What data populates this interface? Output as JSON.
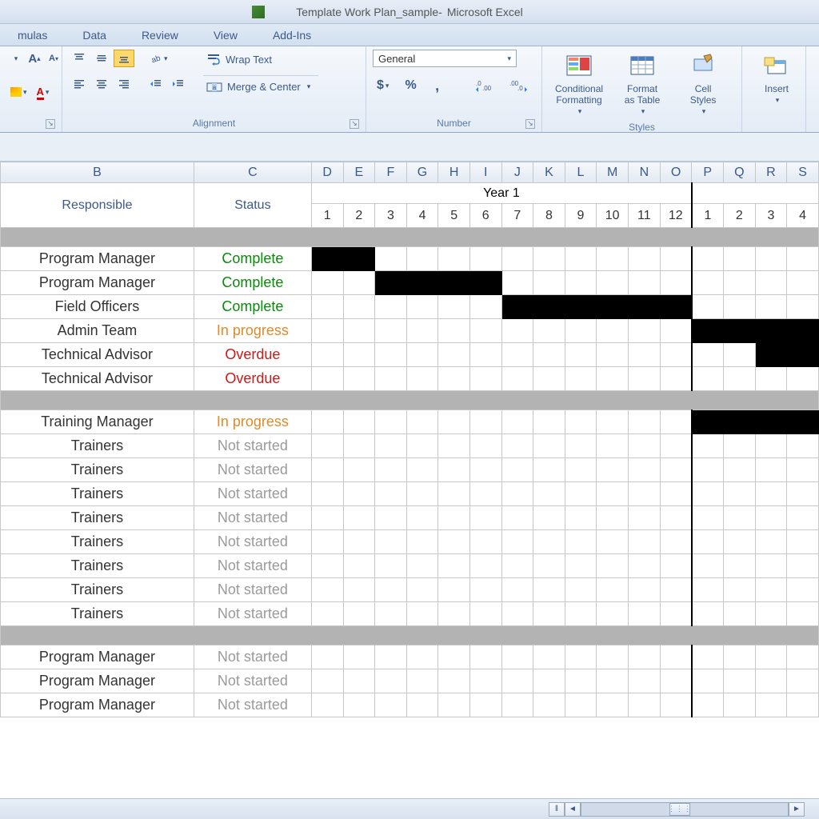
{
  "titlebar": {
    "document": "Template Work Plan_sample",
    "separator": " - ",
    "app": "Microsoft Excel"
  },
  "ribbon_tabs": [
    "mulas",
    "Data",
    "Review",
    "View",
    "Add-Ins"
  ],
  "ribbon": {
    "alignment": {
      "wrap_text": "Wrap Text",
      "merge_center": "Merge & Center",
      "label": "Alignment"
    },
    "number": {
      "format": "General",
      "label": "Number"
    },
    "styles": {
      "conditional": "Conditional\nFormatting",
      "format_table": "Format\nas Table",
      "cell_styles": "Cell\nStyles",
      "label": "Styles"
    },
    "cells": {
      "insert": "Insert"
    }
  },
  "columns": [
    "B",
    "C",
    "D",
    "E",
    "F",
    "G",
    "H",
    "I",
    "J",
    "K",
    "L",
    "M",
    "N",
    "O",
    "P",
    "Q",
    "R",
    "S"
  ],
  "headers": {
    "responsible": "Responsible",
    "status": "Status",
    "year1": "Year 1",
    "months_y1": [
      "1",
      "2",
      "3",
      "4",
      "5",
      "6",
      "7",
      "8",
      "9",
      "10",
      "11",
      "12"
    ],
    "months_y2": [
      "1",
      "2",
      "3",
      "4"
    ]
  },
  "rows": [
    {
      "type": "section"
    },
    {
      "type": "task",
      "responsible": "Program Manager",
      "status": "Complete",
      "status_class": "complete",
      "fills": [
        1,
        2
      ]
    },
    {
      "type": "task",
      "responsible": "Program Manager",
      "status": "Complete",
      "status_class": "complete",
      "fills": [
        3,
        4,
        5,
        6
      ]
    },
    {
      "type": "task",
      "responsible": "Field Officers",
      "status": "Complete",
      "status_class": "complete",
      "fills": [
        7,
        8,
        9,
        10,
        11,
        12
      ]
    },
    {
      "type": "task",
      "responsible": "Admin Team",
      "status": "In progress",
      "status_class": "in-progress",
      "fills": [
        13,
        14,
        15,
        16
      ]
    },
    {
      "type": "task",
      "responsible": "Technical Advisor",
      "status": "Overdue",
      "status_class": "overdue",
      "fills": [
        15,
        16
      ]
    },
    {
      "type": "task",
      "responsible": "Technical Advisor",
      "status": "Overdue",
      "status_class": "overdue",
      "fills": []
    },
    {
      "type": "section"
    },
    {
      "type": "task",
      "responsible": "Training Manager",
      "status": "In progress",
      "status_class": "in-progress",
      "fills": [
        13,
        14,
        15,
        16
      ]
    },
    {
      "type": "task",
      "responsible": "Trainers",
      "status": "Not started",
      "status_class": "not-started",
      "fills": []
    },
    {
      "type": "task",
      "responsible": "Trainers",
      "status": "Not started",
      "status_class": "not-started",
      "fills": []
    },
    {
      "type": "task",
      "responsible": "Trainers",
      "status": "Not started",
      "status_class": "not-started",
      "fills": []
    },
    {
      "type": "task",
      "responsible": "Trainers",
      "status": "Not started",
      "status_class": "not-started",
      "fills": []
    },
    {
      "type": "task",
      "responsible": "Trainers",
      "status": "Not started",
      "status_class": "not-started",
      "fills": []
    },
    {
      "type": "task",
      "responsible": "Trainers",
      "status": "Not started",
      "status_class": "not-started",
      "fills": []
    },
    {
      "type": "task",
      "responsible": "Trainers",
      "status": "Not started",
      "status_class": "not-started",
      "fills": []
    },
    {
      "type": "task",
      "responsible": "Trainers",
      "status": "Not started",
      "status_class": "not-started",
      "fills": []
    },
    {
      "type": "section"
    },
    {
      "type": "task",
      "responsible": "Program Manager",
      "status": "Not started",
      "status_class": "not-started",
      "fills": []
    },
    {
      "type": "task",
      "responsible": "Program Manager",
      "status": "Not started",
      "status_class": "not-started",
      "fills": []
    },
    {
      "type": "task",
      "responsible": "Program Manager",
      "status": "Not started",
      "status_class": "not-started",
      "fills": []
    }
  ]
}
